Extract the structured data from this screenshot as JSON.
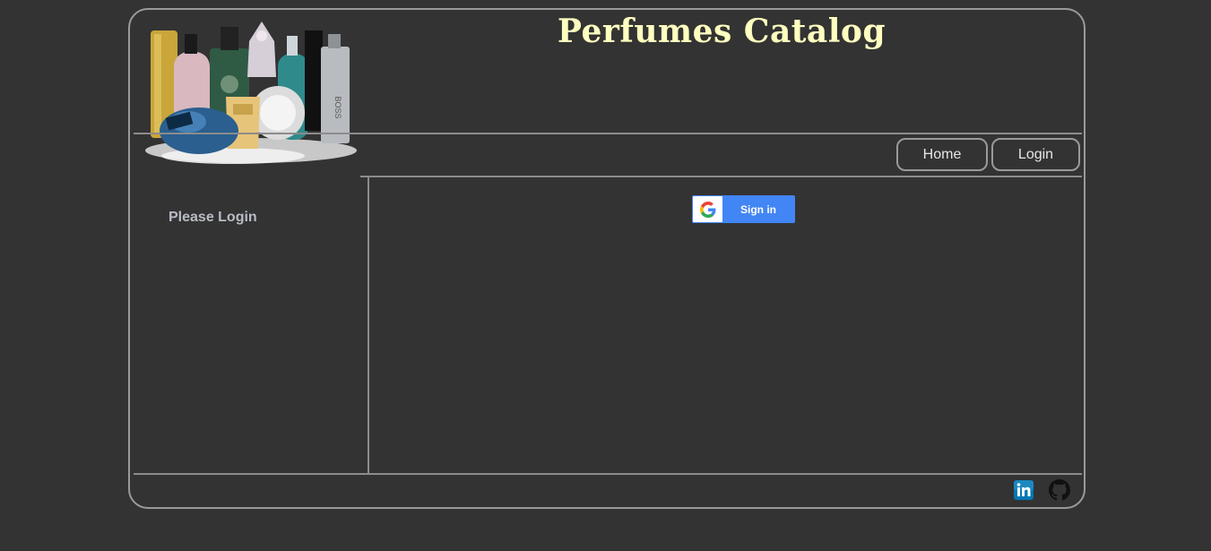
{
  "header": {
    "title": "Perfumes Catalog",
    "logo_alt": "Perfume bottles collage"
  },
  "nav": {
    "home_label": "Home",
    "login_label": "Login"
  },
  "sidebar": {
    "message": "Please Login"
  },
  "main": {
    "google_signin_label": "Sign in"
  },
  "footer": {
    "icons": [
      "linkedin-icon",
      "github-icon"
    ]
  },
  "colors": {
    "background": "#333333",
    "title": "#ffffc0",
    "border": "#9a9a9a",
    "google_blue": "#4285f4"
  }
}
